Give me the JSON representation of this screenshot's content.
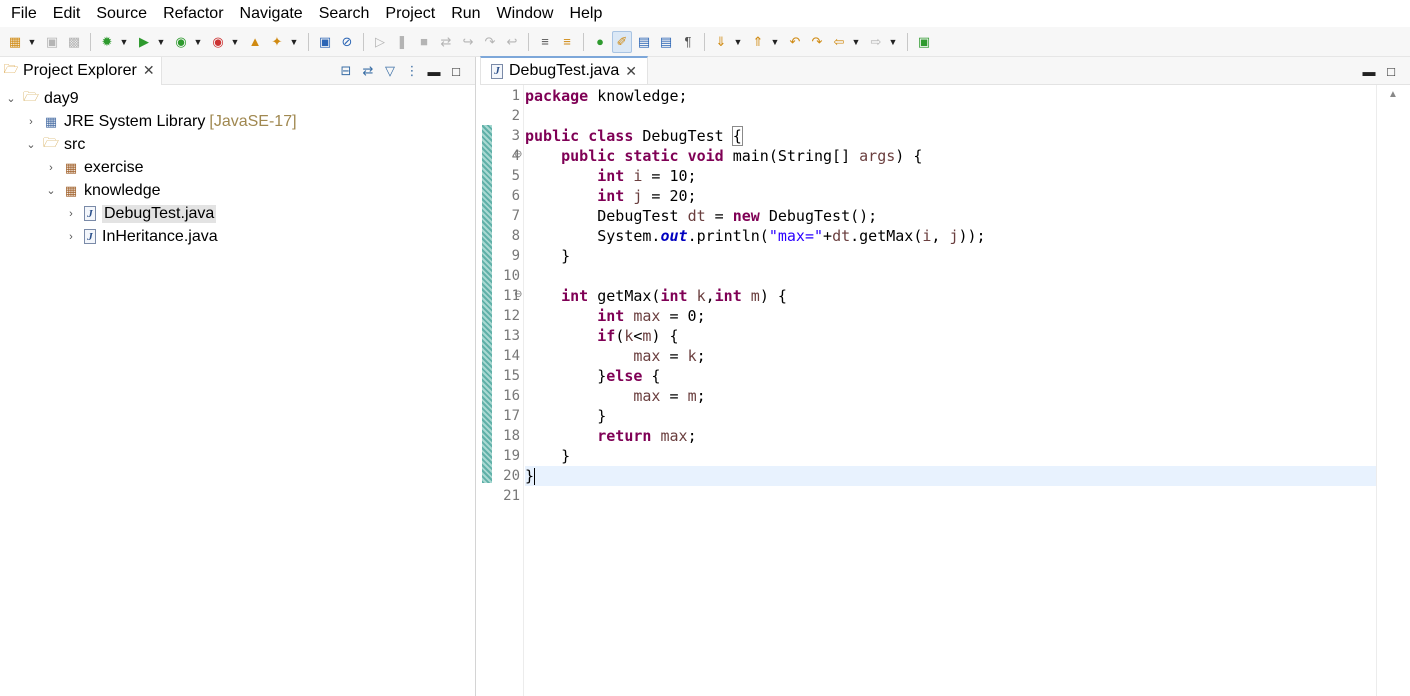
{
  "menu": [
    "File",
    "Edit",
    "Source",
    "Refactor",
    "Navigate",
    "Search",
    "Project",
    "Run",
    "Window",
    "Help"
  ],
  "toolbar": {
    "icons": [
      "new-icon",
      "save-icon",
      "save-all-icon",
      "debug-icon",
      "run-icon",
      "run-coverage-icon",
      "external-tools-icon",
      "open-type-icon",
      "search-icon",
      "task-icon",
      "resume-icon",
      "suspend-icon",
      "terminate-icon",
      "disconnect-icon",
      "step-into-icon",
      "step-over-icon",
      "step-return-icon",
      "toggle-block-icon",
      "mark-occurrences-icon",
      "breadcrumb-icon",
      "word-wrap-icon",
      "whitespace-icon",
      "next-annotation-icon",
      "previous-annotation-icon",
      "last-edit-icon",
      "back-icon",
      "forward-icon",
      "perspective-icon"
    ]
  },
  "explorer": {
    "title": "Project Explorer",
    "tree": [
      {
        "label": "day9",
        "depth": 0,
        "expanded": true,
        "icon": "project-icon"
      },
      {
        "label": "JRE System Library",
        "decor": "[JavaSE-17]",
        "depth": 1,
        "expanded": false,
        "icon": "library-icon"
      },
      {
        "label": "src",
        "depth": 1,
        "expanded": true,
        "icon": "source-folder-icon"
      },
      {
        "label": "exercise",
        "depth": 2,
        "expanded": false,
        "icon": "package-icon"
      },
      {
        "label": "knowledge",
        "depth": 2,
        "expanded": true,
        "icon": "package-icon"
      },
      {
        "label": "DebugTest.java",
        "depth": 3,
        "expanded": false,
        "icon": "java-file-icon",
        "selected": true
      },
      {
        "label": "InHeritance.java",
        "depth": 3,
        "expanded": false,
        "icon": "java-file-icon"
      }
    ]
  },
  "editor": {
    "tab_label": "DebugTest.java",
    "line_numbers": [
      "1",
      "2",
      "3",
      "4",
      "5",
      "6",
      "7",
      "8",
      "9",
      "10",
      "11",
      "12",
      "13",
      "14",
      "15",
      "16",
      "17",
      "18",
      "19",
      "20",
      "21"
    ],
    "current_line": 20,
    "lines": [
      [
        {
          "t": "kw",
          "v": "package"
        },
        {
          "t": "p",
          "v": " knowledge;"
        }
      ],
      [],
      [
        {
          "t": "kw",
          "v": "public"
        },
        {
          "t": "p",
          "v": " "
        },
        {
          "t": "kw",
          "v": "class"
        },
        {
          "t": "p",
          "v": " DebugTest "
        },
        {
          "t": "box",
          "v": "{"
        }
      ],
      [
        {
          "t": "p",
          "v": "    "
        },
        {
          "t": "kw",
          "v": "public"
        },
        {
          "t": "p",
          "v": " "
        },
        {
          "t": "kw",
          "v": "static"
        },
        {
          "t": "p",
          "v": " "
        },
        {
          "t": "kw",
          "v": "void"
        },
        {
          "t": "p",
          "v": " main(String[] "
        },
        {
          "t": "var",
          "v": "args"
        },
        {
          "t": "p",
          "v": ") {"
        }
      ],
      [
        {
          "t": "p",
          "v": "        "
        },
        {
          "t": "kw",
          "v": "int"
        },
        {
          "t": "p",
          "v": " "
        },
        {
          "t": "var",
          "v": "i"
        },
        {
          "t": "p",
          "v": " = 10;"
        }
      ],
      [
        {
          "t": "p",
          "v": "        "
        },
        {
          "t": "kw",
          "v": "int"
        },
        {
          "t": "p",
          "v": " "
        },
        {
          "t": "var",
          "v": "j"
        },
        {
          "t": "p",
          "v": " = 20;"
        }
      ],
      [
        {
          "t": "p",
          "v": "        DebugTest "
        },
        {
          "t": "var",
          "v": "dt"
        },
        {
          "t": "p",
          "v": " = "
        },
        {
          "t": "kw",
          "v": "new"
        },
        {
          "t": "p",
          "v": " DebugTest();"
        }
      ],
      [
        {
          "t": "p",
          "v": "        System."
        },
        {
          "t": "fld",
          "v": "out"
        },
        {
          "t": "p",
          "v": ".println("
        },
        {
          "t": "str",
          "v": "\"max=\""
        },
        {
          "t": "p",
          "v": "+"
        },
        {
          "t": "var",
          "v": "dt"
        },
        {
          "t": "p",
          "v": ".getMax("
        },
        {
          "t": "var",
          "v": "i"
        },
        {
          "t": "p",
          "v": ", "
        },
        {
          "t": "var",
          "v": "j"
        },
        {
          "t": "p",
          "v": "));"
        }
      ],
      [
        {
          "t": "p",
          "v": "    }"
        }
      ],
      [],
      [
        {
          "t": "p",
          "v": "    "
        },
        {
          "t": "kw",
          "v": "int"
        },
        {
          "t": "p",
          "v": " getMax("
        },
        {
          "t": "kw",
          "v": "int"
        },
        {
          "t": "p",
          "v": " "
        },
        {
          "t": "var",
          "v": "k"
        },
        {
          "t": "p",
          "v": ","
        },
        {
          "t": "kw",
          "v": "int"
        },
        {
          "t": "p",
          "v": " "
        },
        {
          "t": "var",
          "v": "m"
        },
        {
          "t": "p",
          "v": ") {"
        }
      ],
      [
        {
          "t": "p",
          "v": "        "
        },
        {
          "t": "kw",
          "v": "int"
        },
        {
          "t": "p",
          "v": " "
        },
        {
          "t": "var",
          "v": "max"
        },
        {
          "t": "p",
          "v": " = 0;"
        }
      ],
      [
        {
          "t": "p",
          "v": "        "
        },
        {
          "t": "kw",
          "v": "if"
        },
        {
          "t": "p",
          "v": "("
        },
        {
          "t": "var",
          "v": "k"
        },
        {
          "t": "p",
          "v": "<"
        },
        {
          "t": "var",
          "v": "m"
        },
        {
          "t": "p",
          "v": ") {"
        }
      ],
      [
        {
          "t": "p",
          "v": "            "
        },
        {
          "t": "var",
          "v": "max"
        },
        {
          "t": "p",
          "v": " = "
        },
        {
          "t": "var",
          "v": "k"
        },
        {
          "t": "p",
          "v": ";"
        }
      ],
      [
        {
          "t": "p",
          "v": "        }"
        },
        {
          "t": "kw",
          "v": "else"
        },
        {
          "t": "p",
          "v": " {"
        }
      ],
      [
        {
          "t": "p",
          "v": "            "
        },
        {
          "t": "var",
          "v": "max"
        },
        {
          "t": "p",
          "v": " = "
        },
        {
          "t": "var",
          "v": "m"
        },
        {
          "t": "p",
          "v": ";"
        }
      ],
      [
        {
          "t": "p",
          "v": "        }"
        }
      ],
      [
        {
          "t": "p",
          "v": "        "
        },
        {
          "t": "kw",
          "v": "return"
        },
        {
          "t": "p",
          "v": " "
        },
        {
          "t": "var",
          "v": "max"
        },
        {
          "t": "p",
          "v": ";"
        }
      ],
      [
        {
          "t": "p",
          "v": "    }"
        }
      ],
      [
        {
          "t": "p",
          "v": "}"
        },
        {
          "t": "caret",
          "v": ""
        }
      ],
      []
    ]
  },
  "colors": {
    "keyword": "#7f0055",
    "string": "#2a00ff",
    "field": "#0000c0",
    "local_var": "#6a3e3e",
    "current_line": "#e8f2fe",
    "library_decor": "#a08850"
  }
}
